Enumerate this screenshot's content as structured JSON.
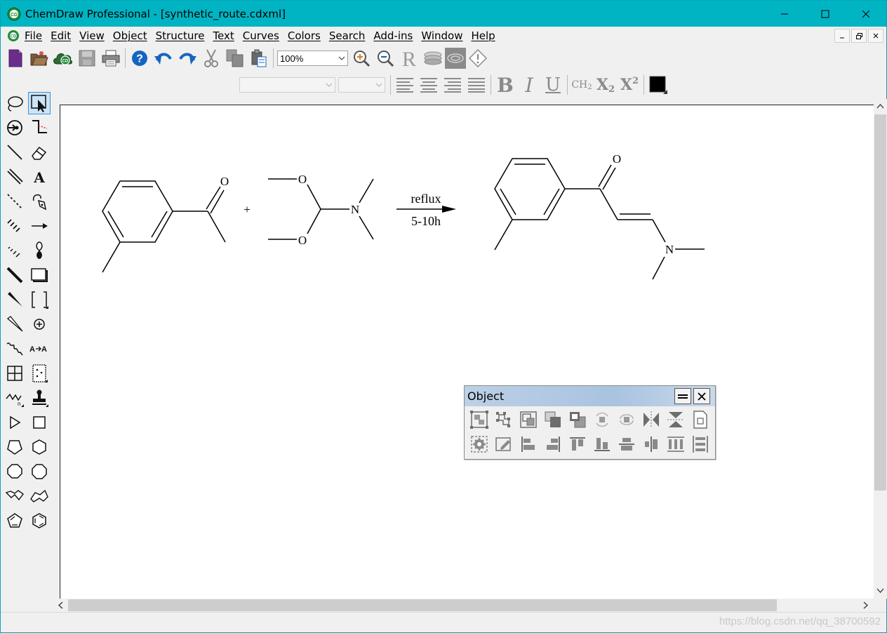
{
  "window": {
    "title": "ChemDraw Professional - [synthetic_route.cdxml]",
    "app_icon": "chemdraw-cd-icon"
  },
  "menubar": {
    "items": [
      "File",
      "Edit",
      "View",
      "Object",
      "Structure",
      "Text",
      "Curves",
      "Colors",
      "Search",
      "Add-ins",
      "Window",
      "Help"
    ]
  },
  "toolbar": {
    "zoom_value": "100%",
    "font_name": "",
    "font_size": "",
    "color_swatch": "#000000",
    "bold_label": "B",
    "italic_label": "I",
    "underline_label": "U",
    "ch2_label": "CH",
    "ch2_sub": "2",
    "subscript_label": "X",
    "subscript_sub": "2",
    "superscript_label": "X",
    "superscript_sup": "2"
  },
  "canvas": {
    "reactant1": {
      "atoms": [
        "O"
      ]
    },
    "plus_sign": "+",
    "reactant2": {
      "atoms": [
        "O",
        "O",
        "N"
      ]
    },
    "arrow": {
      "above": "reflux",
      "below": "5-10h"
    },
    "product": {
      "atoms": [
        "O",
        "N"
      ]
    }
  },
  "object_panel": {
    "title": "Object"
  },
  "statusbar": {
    "watermark": "https://blog.csdn.net/qq_38700592"
  },
  "colors": {
    "titlebar": "#00b4c3",
    "selection": "#cce4f7",
    "accent_blue": "#1565c0"
  }
}
